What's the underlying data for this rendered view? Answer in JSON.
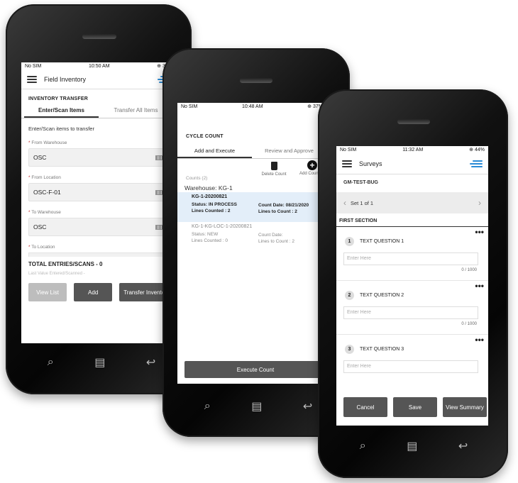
{
  "phone1": {
    "status": {
      "carrier": "No SIM",
      "time": "10:50 AM",
      "battery": "30%"
    },
    "app_title": "Field Inventory",
    "section_title": "INVENTORY TRANSFER",
    "tabs": [
      "Enter/Scan Items",
      "Transfer All Items"
    ],
    "instruction": "Enter/Scan items to transfer",
    "fields": [
      {
        "label": "From Warehouse",
        "value": "OSC"
      },
      {
        "label": "From Location",
        "value": "OSC-F-01"
      },
      {
        "label": "To Warehouse",
        "value": "OSC"
      },
      {
        "label": "To Location",
        "value": ""
      }
    ],
    "total": "TOTAL ENTRIES/SCANS - 0",
    "last_value": "Last Value Entered/Scanned -",
    "buttons": {
      "view_list": "View List",
      "add": "Add",
      "transfer": "Transfer Inventory"
    }
  },
  "phone2": {
    "status": {
      "carrier": "No SIM",
      "time": "10:48 AM",
      "battery": "37%"
    },
    "section_title": "CYCLE COUNT",
    "tabs": [
      "Add and Execute",
      "Review and Approve"
    ],
    "counts_label": "Counts (2)",
    "actions": {
      "delete": "Delete Count",
      "add": "Add Count"
    },
    "warehouse": "Warehouse: KG-1",
    "counts": [
      {
        "id": "KG-1-20200821",
        "status": "Status: IN PROCESS",
        "count_date": "Count Date: 08/21/2020",
        "lines_counted": "Lines Counted : 2",
        "lines_to_count": "Lines to Count : 2"
      },
      {
        "id": "KG-1-KG-LOC-1-20200821",
        "status": "Status: NEW",
        "count_date": "Count Date:",
        "lines_counted": "Lines Counted : 0",
        "lines_to_count": "Lines to Count : 2"
      }
    ],
    "execute_label": "Execute Count"
  },
  "phone3": {
    "status": {
      "carrier": "No SIM",
      "time": "11:32 AM",
      "battery": "44%"
    },
    "app_title": "Surveys",
    "survey_name": "GM-TEST-BUG",
    "set_label": "Set 1 of 1",
    "section_label": "FIRST SECTION",
    "questions": [
      {
        "num": "1",
        "label": "TEXT QUESTION 1",
        "placeholder": "Enter Here",
        "counter": "0 / 1000"
      },
      {
        "num": "2",
        "label": "TEXT QUESTION 2",
        "placeholder": "Enter Here",
        "counter": "0 / 1000"
      },
      {
        "num": "3",
        "label": "TEXT QUESTION 3",
        "placeholder": "Enter Here",
        "counter": ""
      }
    ],
    "buttons": {
      "cancel": "Cancel",
      "save": "Save",
      "summary": "View Summary"
    }
  },
  "colors": {
    "accent": "#2b8bd6",
    "button_dark": "#555555",
    "button_light": "#bdbdbd",
    "selected_row": "#e3eef9",
    "required": "#c62828"
  }
}
